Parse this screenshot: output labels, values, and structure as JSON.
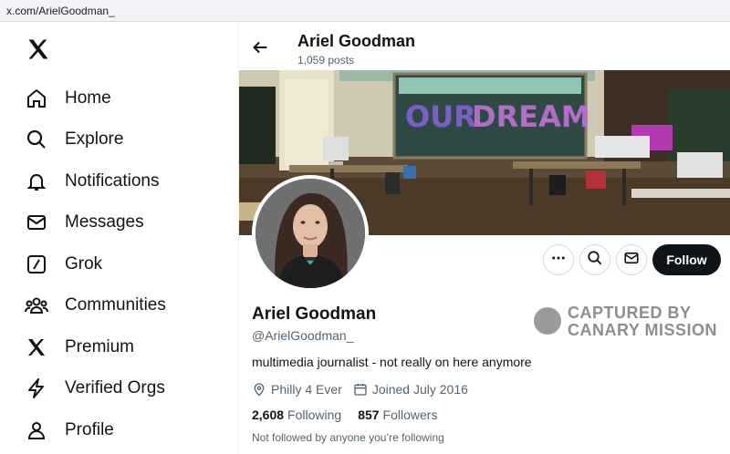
{
  "browser": {
    "url": "x.com/ArielGoodman_"
  },
  "sidebar": {
    "logo_icon": "x-logo-icon",
    "items": [
      {
        "label": "Home",
        "icon": "home-icon"
      },
      {
        "label": "Explore",
        "icon": "search-icon"
      },
      {
        "label": "Notifications",
        "icon": "bell-icon"
      },
      {
        "label": "Messages",
        "icon": "envelope-icon"
      },
      {
        "label": "Grok",
        "icon": "grok-icon"
      },
      {
        "label": "Communities",
        "icon": "people-icon"
      },
      {
        "label": "Premium",
        "icon": "x-logo-icon"
      },
      {
        "label": "Verified Orgs",
        "icon": "lightning-icon"
      },
      {
        "label": "Profile",
        "icon": "person-icon"
      }
    ]
  },
  "header": {
    "name": "Ariel Goodman",
    "posts": "1,059 posts"
  },
  "banner": {
    "chalkboard_text": "OUR DREAM"
  },
  "actions": {
    "follow_label": "Follow",
    "more_icon": "more-icon",
    "search_icon": "search-icon",
    "message_icon": "envelope-icon"
  },
  "profile": {
    "name": "Ariel Goodman",
    "handle": "@ArielGoodman_",
    "bio": "multimedia journalist - not really on here anymore",
    "location": "Philly 4 Ever",
    "joined": "Joined July 2016",
    "following_count": "2,608",
    "following_label": "Following",
    "followers_count": "857",
    "followers_label": "Followers",
    "not_followed": "Not followed by anyone you’re following"
  },
  "watermark": {
    "line1": "CAPTURED BY",
    "line2": "CANARY MISSION"
  }
}
